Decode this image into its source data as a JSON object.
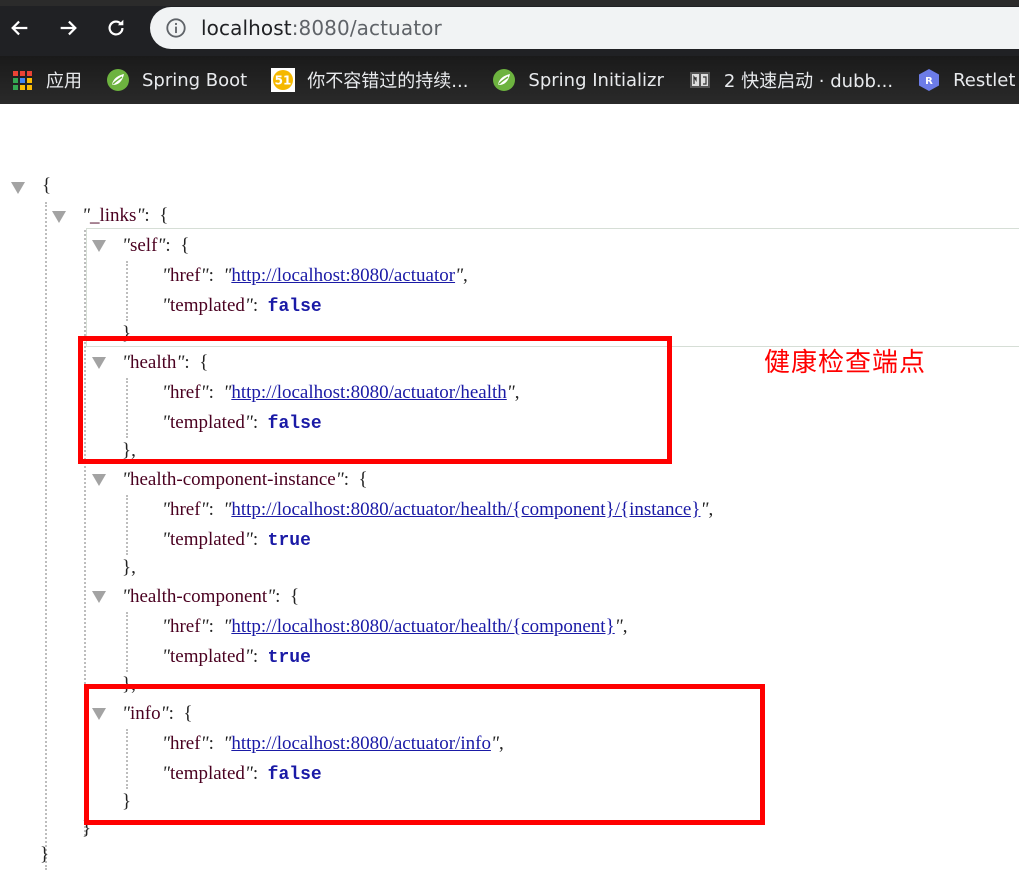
{
  "browser": {
    "url_host": "localhost",
    "url_rest": ":8080/actuator",
    "bookmarks": [
      {
        "icon": "apps-grid-icon",
        "label": "应用"
      },
      {
        "icon": "spring-leaf-icon",
        "label": "Spring Boot"
      },
      {
        "icon": "51cto-icon",
        "label": "你不容错过的持续..."
      },
      {
        "icon": "spring-leaf-icon",
        "label": "Spring Initializr"
      },
      {
        "icon": "gitbook-icon",
        "label": "2 快速启动 · dubb..."
      },
      {
        "icon": "restlet-icon",
        "label": "Restlet"
      }
    ]
  },
  "json": {
    "open_brace": "{",
    "close_brace": "}",
    "links_key": "_links",
    "entries": [
      {
        "key": "self",
        "href": "http://localhost:8080/actuator",
        "templated": "false",
        "close": "}"
      },
      {
        "key": "health",
        "href": "http://localhost:8080/actuator/health",
        "templated": "false",
        "close": "},"
      },
      {
        "key": "health-component-instance",
        "href": "http://localhost:8080/actuator/health/{component}/{instance}",
        "templated": "true",
        "close": "},"
      },
      {
        "key": "health-component",
        "href": "http://localhost:8080/actuator/health/{component}",
        "templated": "true",
        "close": "},"
      },
      {
        "key": "info",
        "href": "http://localhost:8080/actuator/info",
        "templated": "false",
        "close": "}"
      }
    ],
    "href_key": "href",
    "templated_key": "templated"
  },
  "annotation": {
    "text": "健康检查端点",
    "color": "#ff0000"
  }
}
